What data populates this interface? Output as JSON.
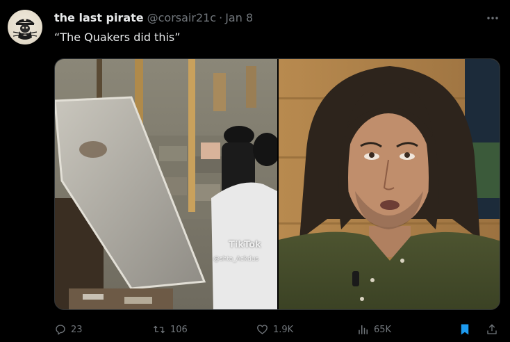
{
  "tweet": {
    "display_name": "the last pirate",
    "handle": "@corsair21c",
    "separator": "·",
    "date": "Jan 8",
    "text": "“The Quakers did this”"
  },
  "media": {
    "left_image": {
      "watermark_brand": "TikTok",
      "watermark_handle": "@shta_Ackdus"
    }
  },
  "actions": {
    "replies": "23",
    "retweets": "106",
    "likes": "1.9K",
    "views": "65K"
  },
  "icons": {
    "more": "more-icon",
    "reply": "reply-icon",
    "retweet": "retweet-icon",
    "like": "heart-icon",
    "views": "views-icon",
    "bookmark": "bookmark-icon",
    "share": "share-icon"
  },
  "colors": {
    "background": "#000000",
    "primary_text": "#e7e9ea",
    "secondary_text": "#71767b",
    "bookmark_active": "#1d9bf0",
    "border": "#2f3336"
  }
}
